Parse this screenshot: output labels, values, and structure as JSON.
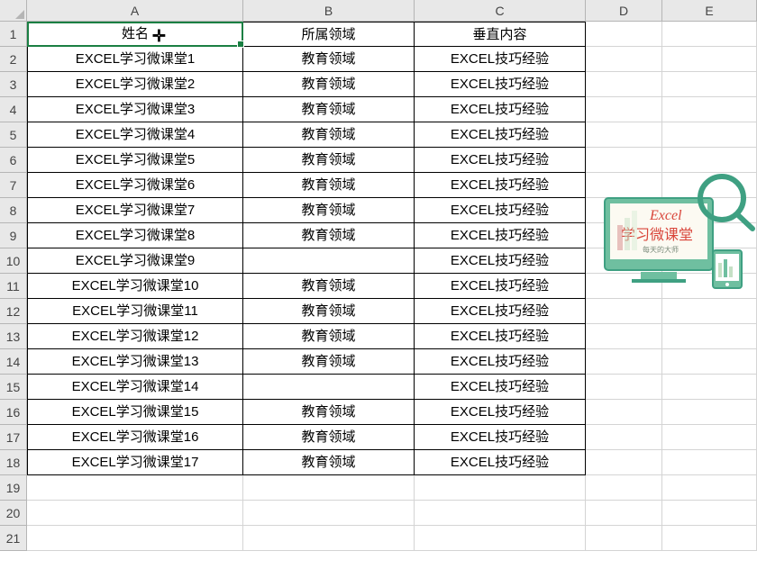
{
  "columns": [
    "A",
    "B",
    "C",
    "D",
    "E"
  ],
  "rowCount": 21,
  "headers": {
    "A": "姓名",
    "B": "所属领域",
    "C": "垂直内容"
  },
  "activeCell": "A1",
  "rows": [
    {
      "A": "EXCEL学习微课堂1",
      "B": "教育领域",
      "C": "EXCEL技巧经验"
    },
    {
      "A": "EXCEL学习微课堂2",
      "B": "教育领域",
      "C": "EXCEL技巧经验"
    },
    {
      "A": "EXCEL学习微课堂3",
      "B": "教育领域",
      "C": "EXCEL技巧经验"
    },
    {
      "A": "EXCEL学习微课堂4",
      "B": "教育领域",
      "C": "EXCEL技巧经验"
    },
    {
      "A": "EXCEL学习微课堂5",
      "B": "教育领域",
      "C": "EXCEL技巧经验"
    },
    {
      "A": "EXCEL学习微课堂6",
      "B": "教育领域",
      "C": "EXCEL技巧经验"
    },
    {
      "A": "EXCEL学习微课堂7",
      "B": "教育领域",
      "C": "EXCEL技巧经验"
    },
    {
      "A": "EXCEL学习微课堂8",
      "B": "教育领域",
      "C": "EXCEL技巧经验"
    },
    {
      "A": "EXCEL学习微课堂9",
      "B": "",
      "C": "EXCEL技巧经验"
    },
    {
      "A": "EXCEL学习微课堂10",
      "B": "教育领域",
      "C": "EXCEL技巧经验"
    },
    {
      "A": "EXCEL学习微课堂11",
      "B": "教育领域",
      "C": "EXCEL技巧经验"
    },
    {
      "A": "EXCEL学习微课堂12",
      "B": "教育领域",
      "C": "EXCEL技巧经验"
    },
    {
      "A": "EXCEL学习微课堂13",
      "B": "教育领域",
      "C": "EXCEL技巧经验"
    },
    {
      "A": "EXCEL学习微课堂14",
      "B": "",
      "C": "EXCEL技巧经验"
    },
    {
      "A": "EXCEL学习微课堂15",
      "B": "教育领域",
      "C": "EXCEL技巧经验"
    },
    {
      "A": "EXCEL学习微课堂16",
      "B": "教育领域",
      "C": "EXCEL技巧经验"
    },
    {
      "A": "EXCEL学习微课堂17",
      "B": "教育领域",
      "C": "EXCEL技巧经验"
    }
  ],
  "watermark": {
    "title": "Excel",
    "subtitle": "学习微课堂",
    "tagline": "每天的大师"
  }
}
